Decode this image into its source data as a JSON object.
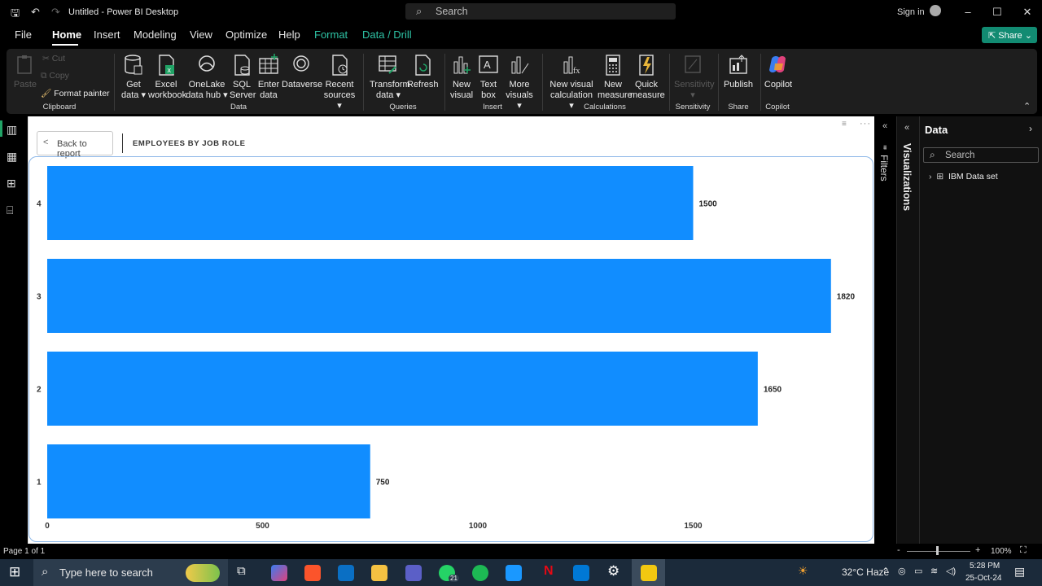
{
  "window": {
    "title": "Untitled - Power BI Desktop",
    "search_placeholder": "Search",
    "sign_in": "Sign in"
  },
  "menu": {
    "items": [
      "File",
      "Home",
      "Insert",
      "Modeling",
      "View",
      "Optimize",
      "Help",
      "Format",
      "Data / Drill"
    ],
    "active": "Home",
    "share": "Share"
  },
  "ribbon": {
    "clipboard": {
      "paste": "Paste",
      "cut": "Cut",
      "copy": "Copy",
      "format_painter": "Format painter",
      "group": "Clipboard"
    },
    "data": {
      "get_data": [
        "Get",
        "data ▾"
      ],
      "excel": [
        "Excel",
        "workbook"
      ],
      "onelake": [
        "OneLake",
        "data hub ▾"
      ],
      "sql": [
        "SQL",
        "Server"
      ],
      "enter": [
        "Enter",
        "data"
      ],
      "dataverse": [
        "Dataverse",
        ""
      ],
      "recent": [
        "Recent",
        "sources ▾"
      ],
      "group": "Data"
    },
    "queries": {
      "transform": [
        "Transform",
        "data ▾"
      ],
      "refresh": [
        "Refresh",
        ""
      ],
      "group": "Queries"
    },
    "insert": {
      "new_visual": [
        "New",
        "visual"
      ],
      "text_box": [
        "Text",
        "box"
      ],
      "more_visuals": [
        "More",
        "visuals ▾"
      ],
      "group": "Insert"
    },
    "calculations": {
      "new_visual_calc": [
        "New visual",
        "calculation ▾"
      ],
      "new_measure": [
        "New",
        "measure"
      ],
      "quick_measure": [
        "Quick",
        "measure"
      ],
      "group": "Calculations"
    },
    "sensitivity": {
      "label": [
        "Sensitivity",
        "▾"
      ],
      "group": "Sensitivity"
    },
    "share": {
      "publish": "Publish",
      "group": "Share"
    },
    "copilot": {
      "label": "Copilot",
      "group": "Copilot"
    }
  },
  "canvas": {
    "back_button": "Back to report",
    "visual_title": "EMPLOYEES BY JOB ROLE"
  },
  "chart_data": {
    "type": "bar",
    "orientation": "horizontal",
    "categories": [
      "4",
      "3",
      "2",
      "1"
    ],
    "values": [
      1500,
      1820,
      1650,
      750
    ],
    "data_labels": [
      "1500",
      "1820",
      "1650",
      "750"
    ],
    "x_ticks": [
      "0",
      "500",
      "1000",
      "1500"
    ],
    "xlim": [
      0,
      1850
    ],
    "bar_color": "#118dff",
    "title": "EMPLOYEES BY JOB ROLE"
  },
  "panes": {
    "filters": "Filters",
    "visualizations": "Visualizations",
    "data_title": "Data",
    "data_search": "Search",
    "dataset": "IBM Data set"
  },
  "status": {
    "page": "Page 1 of 1",
    "zoom": "100%"
  },
  "taskbar": {
    "search": "Type here to search",
    "weather": "32°C  Haze",
    "time": "5:28 PM",
    "date": "25-Oct-24",
    "badge": "21"
  }
}
